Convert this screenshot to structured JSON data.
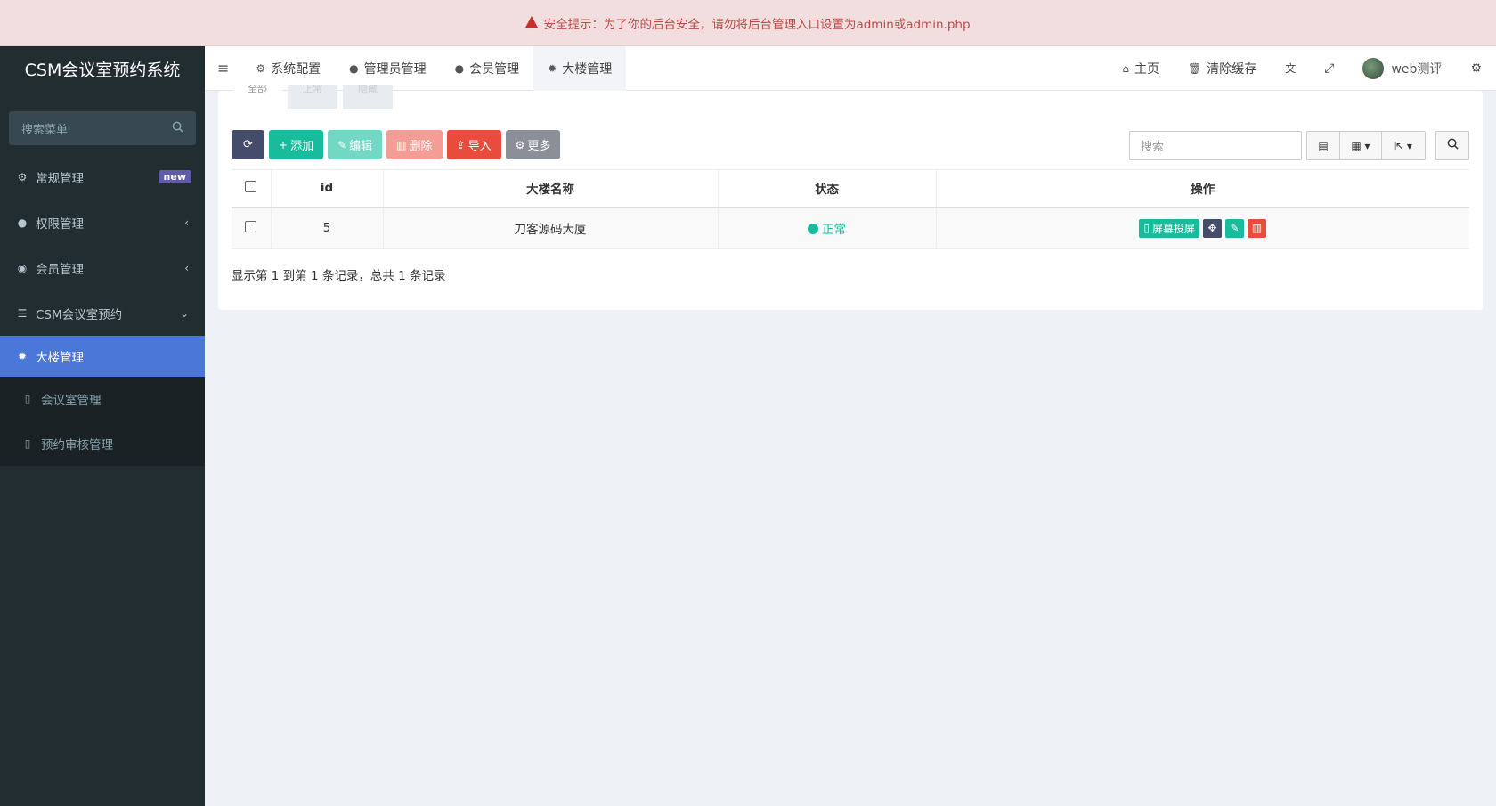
{
  "alert": {
    "text": "安全提示：为了你的后台安全，请勿将后台管理入口设置为admin或admin.php"
  },
  "sidebar": {
    "brand": "CSM会议室预约系统",
    "search_placeholder": "搜索菜单",
    "items": [
      {
        "label": "常规管理",
        "badge": "new"
      },
      {
        "label": "权限管理"
      },
      {
        "label": "会员管理"
      },
      {
        "label": "CSM会议室预约"
      },
      {
        "label": "大楼管理"
      },
      {
        "label": "会议室管理"
      },
      {
        "label": "预约审核管理"
      }
    ]
  },
  "topbar": {
    "tabs": [
      {
        "label": "系统配置"
      },
      {
        "label": "管理员管理"
      },
      {
        "label": "会员管理"
      },
      {
        "label": "大楼管理"
      }
    ],
    "home": "主页",
    "clear_cache": "清除缓存",
    "user": "web测评"
  },
  "subtabs": [
    "全部",
    "正常",
    "隐藏"
  ],
  "toolbar": {
    "add": "添加",
    "edit": "编辑",
    "delete": "删除",
    "import": "导入",
    "more": "更多",
    "search_placeholder": "搜索"
  },
  "table": {
    "headers": {
      "id": "id",
      "name": "大楼名称",
      "status": "状态",
      "ops": "操作"
    },
    "rows": [
      {
        "id": "5",
        "name": "刀客源码大厦",
        "status": "正常",
        "op_screen": "屏幕投屏"
      }
    ]
  },
  "pagination": {
    "summary": "显示第 1 到第 1 条记录，总共 1 条记录"
  },
  "colors": {
    "accent": "#4b77d8",
    "success": "#18bc9c",
    "danger": "#e74c3c",
    "sidebar_bg": "#222d32"
  }
}
